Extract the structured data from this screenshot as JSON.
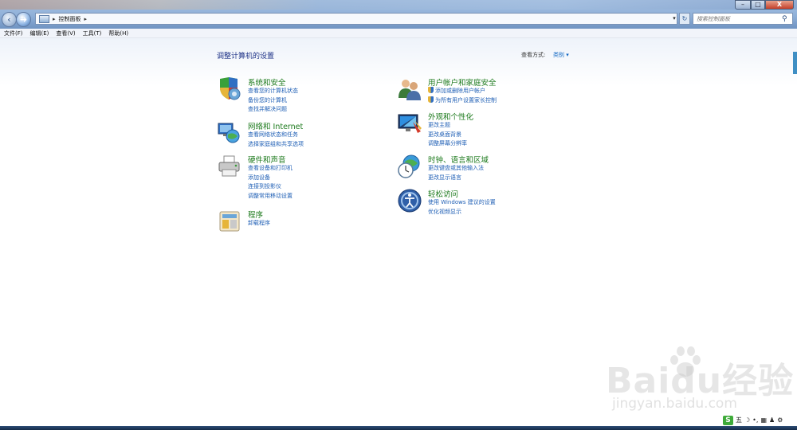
{
  "window": {
    "address_crumb": "控制面板",
    "search_placeholder": "搜索控制面板",
    "minimize": "–",
    "maximize": "□",
    "close": "X"
  },
  "menu": [
    "文件(F)",
    "编辑(E)",
    "查看(V)",
    "工具(T)",
    "帮助(H)"
  ],
  "page": {
    "title": "调整计算机的设置",
    "view_by_label": "查看方式:",
    "view_by_value": "类别 ▾"
  },
  "categories": [
    {
      "title": "系统和安全",
      "icon": "shield-computer-icon",
      "links": [
        "查看您的计算机状态",
        "备份您的计算机",
        "查找并解决问题"
      ]
    },
    {
      "title": "网络和 Internet",
      "icon": "network-globe-icon",
      "links": [
        "查看网络状态和任务",
        "选择家庭组和共享选项"
      ]
    },
    {
      "title": "硬件和声音",
      "icon": "printer-icon",
      "links": [
        "查看设备和打印机",
        "添加设备",
        "连接到投影仪",
        "调整常用移动设置"
      ]
    },
    {
      "title": "程序",
      "icon": "programs-icon",
      "links": [
        "卸载程序"
      ]
    },
    {
      "title": "用户帐户和家庭安全",
      "icon": "users-icon",
      "links": [
        "添加或删除用户帐户",
        "为所有用户设置家长控制"
      ]
    },
    {
      "title": "外观和个性化",
      "icon": "monitor-icon",
      "links": [
        "更改主题",
        "更改桌面背景",
        "调整屏幕分辨率"
      ]
    },
    {
      "title": "时钟、语言和区域",
      "icon": "clock-globe-icon",
      "links": [
        "更改键盘或其他输入法",
        "更改显示语言"
      ]
    },
    {
      "title": "轻松访问",
      "icon": "ease-of-access-icon",
      "links": [
        "使用 Windows 建议的设置",
        "优化视频显示"
      ]
    }
  ],
  "watermark": {
    "logo": "Baidu经验",
    "url": "jingyan.baidu.com"
  },
  "tray": {
    "ime": "S",
    "mode": "五"
  }
}
